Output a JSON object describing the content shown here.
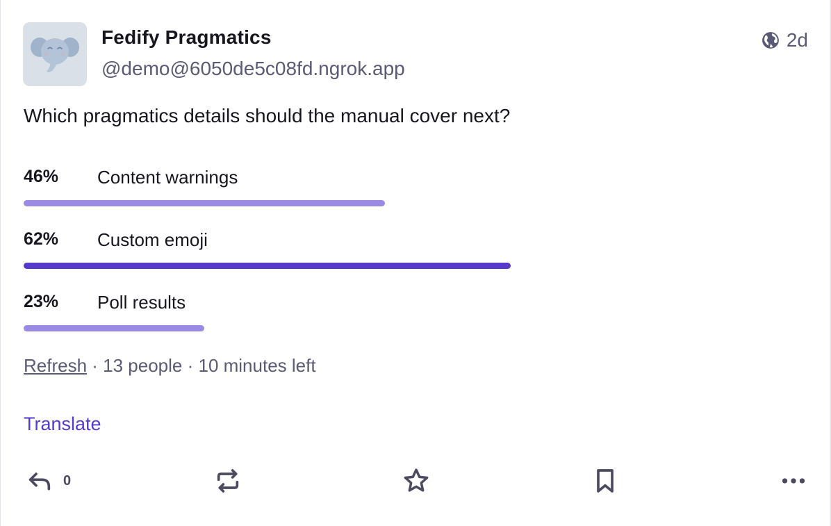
{
  "author": {
    "display_name": "Fedify Pragmatics",
    "handle": "@demo@6050de5c08fd.ngrok.app",
    "avatar_icon": "elephant-icon"
  },
  "meta": {
    "visibility_icon": "globe-icon",
    "relative_time": "2d"
  },
  "status": {
    "text": "Which pragmatics details should the manual cover next?"
  },
  "poll": {
    "options": [
      {
        "percent_label": "46%",
        "percent": 46,
        "label": "Content warnings",
        "leading": false
      },
      {
        "percent_label": "62%",
        "percent": 62,
        "label": "Custom emoji",
        "leading": true
      },
      {
        "percent_label": "23%",
        "percent": 23,
        "label": "Poll results",
        "leading": false
      }
    ],
    "refresh_label": "Refresh",
    "summary": " · 13 people · 10 minutes left"
  },
  "translate_label": "Translate",
  "actions": {
    "reply_icon": "reply-icon",
    "reply_count": "0",
    "boost_icon": "boost-icon",
    "favourite_icon": "star-icon",
    "bookmark_icon": "bookmark-icon",
    "more_icon": "more-icon"
  },
  "colors": {
    "accent": "#563acc",
    "bar_secondary": "#9b8ae4",
    "text_primary": "#17161f",
    "text_secondary": "#5b5a74"
  }
}
